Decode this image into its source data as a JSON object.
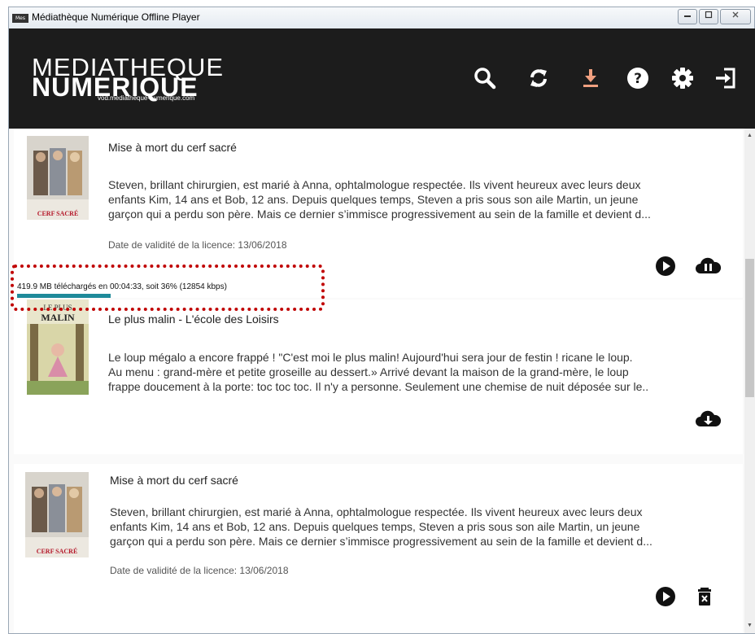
{
  "window": {
    "app_icon_text": "Mes",
    "title": "Médiathèque Numérique Offline Player"
  },
  "header": {
    "logo_line1": "MEDIATHEQUE",
    "logo_line2": "NUMERIQUE",
    "logo_url": "vod.mediatheque-numerique.com",
    "icons": [
      "search-icon",
      "sync-icon",
      "download-icon",
      "help-icon",
      "settings-icon",
      "logout-icon"
    ],
    "download_icon_color": "#f0a080"
  },
  "items": [
    {
      "title": "Mise à mort du cerf sacré",
      "description_lines": [
        "Steven, brillant chirurgien, est marié à Anna, ophtalmologue respectée. Ils vivent heureux avec leurs deux",
        "enfants Kim, 14 ans et Bob, 12 ans. Depuis quelques temps, Steven a pris sous son aile Martin, un jeune",
        "garçon qui a perdu son père. Mais ce dernier s’immisce progressivement au sein de la famille et devient d..."
      ],
      "license": "Date de validité de la licence: 13/06/2018",
      "poster_text": "MISE À MORT DU CERF SACRÉ",
      "poster_actors": "COLIN FARRELL · NICOLE KIDMAN · BARRY KEOGHAN",
      "actions": [
        "play-icon",
        "cloud-pause-icon"
      ],
      "download": {
        "status": "419.9 MB téléchargés en 00:04:33, soit 36% (12854 kbps)",
        "progress": 0.36,
        "color": "#1e8a9a"
      }
    },
    {
      "title": "Le plus malin - L'école des Loisirs",
      "description_lines": [
        "Le loup mégalo a encore frappé !   \"C'est moi le plus malin! Aujourd'hui sera jour de festin ! ricane le loup.",
        "Au menu : grand-mère et petite groseille au dessert.» Arrivé devant la maison de la grand-mère, le loup",
        "frappe doucement à la porte: toc toc toc. Il n'y a personne. Seulement une chemise de nuit déposée sur le.."
      ],
      "poster_text": "LE PLUS MALIN",
      "actions": [
        "cloud-download-icon"
      ]
    },
    {
      "title": "Mise à mort du cerf sacré",
      "description_lines": [
        "Steven, brillant chirurgien, est marié à Anna, ophtalmologue respectée. Ils vivent heureux avec leurs deux",
        "enfants Kim, 14 ans et Bob, 12 ans. Depuis quelques temps, Steven a pris sous son aile Martin, un jeune",
        "garçon qui a perdu son père. Mais ce dernier s’immisce progressivement au sein de la famille et devient d..."
      ],
      "license": "Date de validité de la licence: 13/06/2018",
      "poster_text": "MISE À MORT DU CERF SACRÉ",
      "poster_actors": "COLIN FARRELL · NICOLE KIDMAN · BARRY KEOGHAN",
      "actions": [
        "play-icon",
        "delete-icon"
      ]
    }
  ]
}
